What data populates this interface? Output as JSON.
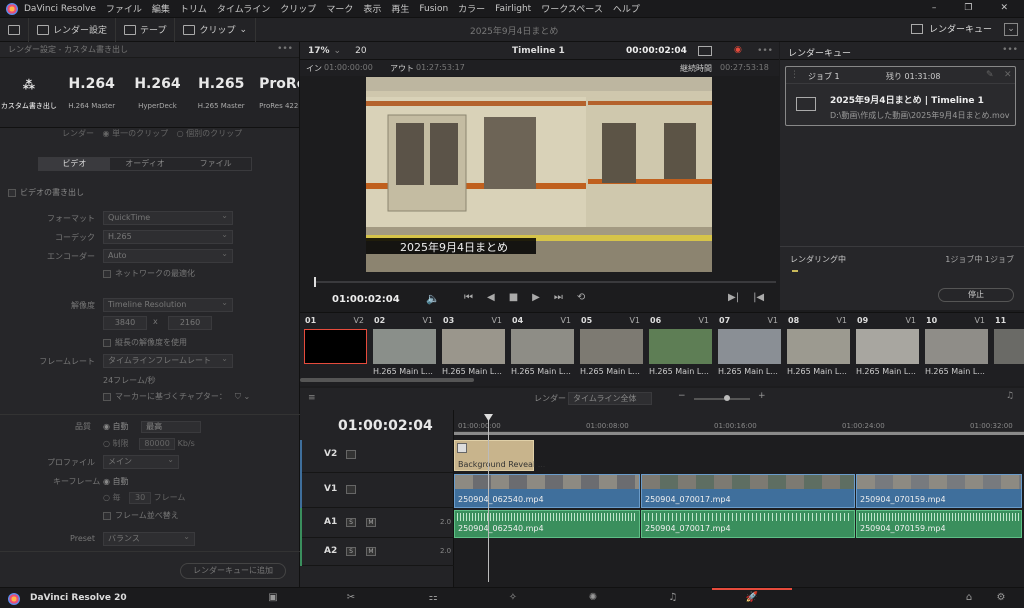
{
  "menu": {
    "app": "DaVinci Resolve",
    "items": [
      "ファイル",
      "編集",
      "トリム",
      "タイムライン",
      "クリップ",
      "マーク",
      "表示",
      "再生",
      "Fusion",
      "カラー",
      "Fairlight",
      "ワークスペース",
      "ヘルプ"
    ],
    "title": "2025年9月4日まとめ"
  },
  "toolbar": {
    "render_settings": "レンダー設定",
    "tape": "テープ",
    "clip": "クリップ",
    "project": "2025年9月4日まとめ",
    "render_queue": "レンダーキュー"
  },
  "left": {
    "header": "レンダー設定 - カスタム書き出し",
    "presets": [
      {
        "big": "",
        "label": "カスタム書き出し"
      },
      {
        "big": "H.264",
        "label": "H.264 Master"
      },
      {
        "big": "H.264",
        "label": "HyperDeck"
      },
      {
        "big": "H.265",
        "label": "H.265 Master"
      },
      {
        "big": "ProRes",
        "label": "ProRes 422"
      }
    ],
    "render_label": "レンダー",
    "render_single": "単一のクリップ",
    "render_individual": "個別のクリップ",
    "tabs": [
      "ビデオ",
      "オーディオ",
      "ファイル"
    ],
    "export_video": "ビデオの書き出し",
    "format_label": "フォーマット",
    "format": "QuickTime",
    "codec_label": "コーデック",
    "codec": "H.265",
    "encoder_label": "エンコーダー",
    "encoder": "Auto",
    "network_opt": "ネットワークの最適化",
    "resolution_label": "解像度",
    "resolution": "Timeline Resolution",
    "res_w": "3840",
    "res_x": "x",
    "res_h": "2160",
    "vertical_res": "縦長の解像度を使用",
    "framerate_label": "フレームレート",
    "framerate": "タイムラインフレームレート",
    "fps": "24フレーム/秒",
    "chapters": "マーカーに基づくチャプター：",
    "quality_label": "品質",
    "q_auto": "自動",
    "q_best": "最高",
    "q_limit": "制限",
    "q_kbps": "80000",
    "q_kbps_unit": "Kb/s",
    "profile_label": "プロファイル",
    "profile": "メイン",
    "keyframe_label": "キーフレーム",
    "kf_auto": "自動",
    "kf_every": "毎",
    "kf_num": "30",
    "kf_frames": "フレーム",
    "frame_reorder": "フレーム並べ替え",
    "preset_label": "Preset",
    "preset": "バランス",
    "add_queue": "レンダーキューに追加"
  },
  "viewer": {
    "zoom": "17%",
    "zoom_num": "20",
    "timeline": "Timeline 1",
    "timecode": "00:00:02:04",
    "in_label": "イン",
    "in_tc": "01:00:00:00",
    "out_label": "アウト",
    "out_tc": "01:27:53:17",
    "dur_label": "継続時間",
    "dur_tc": "00:27:53:18",
    "caption": "2025年9月4日まとめ",
    "play_tc": "01:00:02:04"
  },
  "queue": {
    "title": "レンダーキュー",
    "job": "ジョブ 1",
    "remaining": "残り 01:31:08",
    "job_title": "2025年9月4日まとめ | Timeline 1",
    "job_path": "D:\\動画\\作成した動画\\2025年9月4日まとめ.mov",
    "rendering": "レンダリング中",
    "count": "1ジョブ中 1ジョブ",
    "stop": "停止"
  },
  "clips": [
    {
      "n": "01",
      "t": "V2",
      "name": ""
    },
    {
      "n": "02",
      "t": "V1",
      "name": "H.265 Main L..."
    },
    {
      "n": "03",
      "t": "V1",
      "name": "H.265 Main L..."
    },
    {
      "n": "04",
      "t": "V1",
      "name": "H.265 Main L..."
    },
    {
      "n": "05",
      "t": "V1",
      "name": "H.265 Main L..."
    },
    {
      "n": "06",
      "t": "V1",
      "name": "H.265 Main L..."
    },
    {
      "n": "07",
      "t": "V1",
      "name": "H.265 Main L..."
    },
    {
      "n": "08",
      "t": "V1",
      "name": "H.265 Main L..."
    },
    {
      "n": "09",
      "t": "V1",
      "name": "H.265 Main L..."
    },
    {
      "n": "10",
      "t": "V1",
      "name": "H.265 Main L..."
    },
    {
      "n": "11",
      "t": "",
      "name": ""
    }
  ],
  "timeline": {
    "render_label": "レンダー",
    "render_scope": "タイムライン全体",
    "tc": "01:00:02:04",
    "ruler": [
      "01:00:00:00",
      "01:00:08:00",
      "01:00:16:00",
      "01:00:24:00",
      "01:00:32:00"
    ],
    "tracks": [
      {
        "name": "V2",
        "num": ""
      },
      {
        "name": "V1",
        "num": ""
      },
      {
        "name": "A1",
        "num": "2.0"
      },
      {
        "name": "A2",
        "num": "2.0"
      }
    ],
    "v2clip": "Background Reveal ...",
    "v1clips": [
      "250904_062540.mp4",
      "250904_070017.mp4",
      "250904_070159.mp4"
    ],
    "a1clips": [
      "250904_062540.mp4",
      "250904_070017.mp4",
      "250904_070159.mp4"
    ]
  },
  "footer": {
    "app": "DaVinci Resolve 20"
  },
  "colors": {
    "accent": "#e64b3c",
    "video_clip": "#3f6f9c",
    "audio_clip": "#3a8f5d"
  }
}
